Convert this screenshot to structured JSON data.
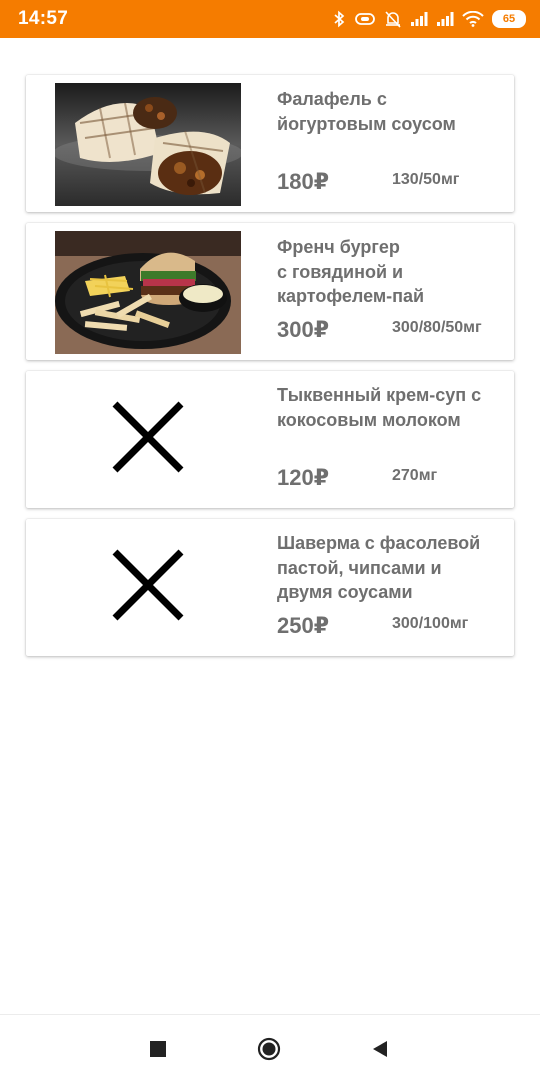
{
  "status_bar": {
    "time": "14:57",
    "battery": "65",
    "icons": [
      "bluetooth-icon",
      "vibrate-icon",
      "bell-off-icon",
      "signal-icon",
      "signal-icon",
      "wifi-icon",
      "battery-icon"
    ],
    "color": "#f57c00"
  },
  "menu": {
    "items": [
      {
        "title": "Фалафель с\nйогуртовым соусом",
        "price": "180₽",
        "weight": "130/50мг",
        "image": "falafel-wrap-photo"
      },
      {
        "title": "Френч бургер\nс говядиной и\nкартофелем-пай",
        "price": "300₽",
        "weight": "300/80/50мг",
        "image": "burger-fries-photo"
      },
      {
        "title": "Тыквенный крем-суп с\nкокосовым молоком",
        "price": "120₽",
        "weight": "270мг",
        "image": "no-image-icon"
      },
      {
        "title": "Шаверма с фасолевой\nпастой, чипсами и\nдвумя соусами",
        "price": "250₽",
        "weight": "300/100мг",
        "image": "no-image-icon"
      }
    ]
  },
  "nav_bar": {
    "buttons": [
      "recents-button",
      "home-button",
      "back-button"
    ]
  }
}
